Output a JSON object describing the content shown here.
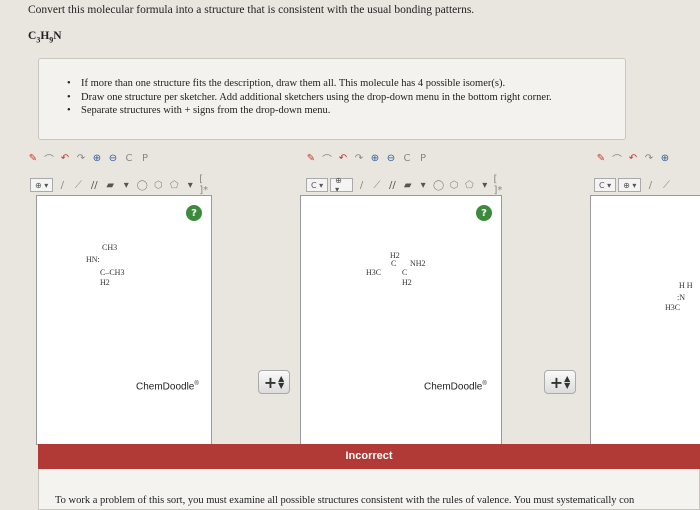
{
  "question": {
    "title": "Convert this molecular formula into a structure that is consistent with the usual bonding patterns.",
    "formula_parts": [
      "C",
      "3",
      "H",
      "9",
      "N"
    ]
  },
  "instructions": [
    "If more than one structure fits the description, draw them all. This molecule has 4 possible isomer(s).",
    "Draw one structure per sketcher. Add additional sketchers using the drop-down menu in the bottom right corner.",
    "Separate structures with + signs from the drop-down menu."
  ],
  "sketchers": [
    {
      "brand": "ChemDoodle",
      "brand_mark": "®",
      "help_label": "?",
      "atoms": [
        "CH3",
        "HN:",
        "C–CH3",
        "H2"
      ]
    },
    {
      "brand": "ChemDoodle",
      "brand_mark": "®",
      "help_label": "?",
      "atoms": [
        "H2",
        "H3C",
        "NH2",
        "H2",
        "C",
        "C"
      ]
    },
    {
      "atoms": [
        "H H",
        ":N",
        "H3C"
      ]
    }
  ],
  "toolbar": {
    "element_label": "C",
    "ring_label": "[ ]*",
    "more_label": "▾"
  },
  "plus_button": {
    "label": "+"
  },
  "feedback": {
    "status": "Incorrect",
    "message": "To work a problem of this sort, you must examine all possible structures consistent with the rules of valence. You must systematically con",
    "status_color": "#b23a36"
  }
}
